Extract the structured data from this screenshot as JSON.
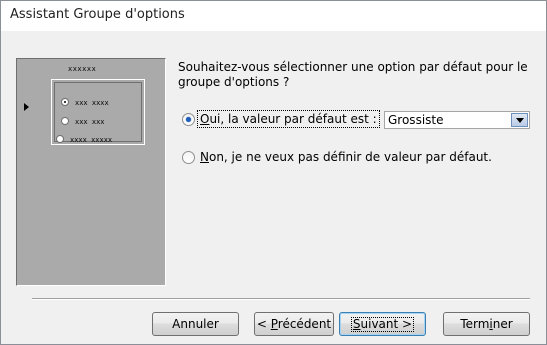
{
  "window": {
    "title": "Assistant Groupe d'options"
  },
  "preview": {
    "frame_label": "xxxxxx",
    "options": [
      "xxx xxxx",
      "xxx xxx",
      "xxxx xxxxx"
    ]
  },
  "question": "Souhaitez-vous sélectionner une option par défaut pour le groupe d'options ?",
  "option_yes": {
    "mnemonic": "O",
    "rest": "ui, la valeur par défaut est :",
    "checked": true
  },
  "option_no": {
    "mnemonic": "N",
    "rest": "on, je ne veux pas définir de valeur par défaut.",
    "checked": false
  },
  "default_combo": {
    "value": "Grossiste"
  },
  "buttons": {
    "cancel": {
      "label": "Annuler"
    },
    "back": {
      "prefix": "< ",
      "mnemonic": "P",
      "rest": "récédent"
    },
    "next": {
      "mnemonic": "S",
      "rest": "uivant >"
    },
    "finish": {
      "prefix": "Term",
      "mnemonic": "i",
      "rest": "ner"
    }
  }
}
